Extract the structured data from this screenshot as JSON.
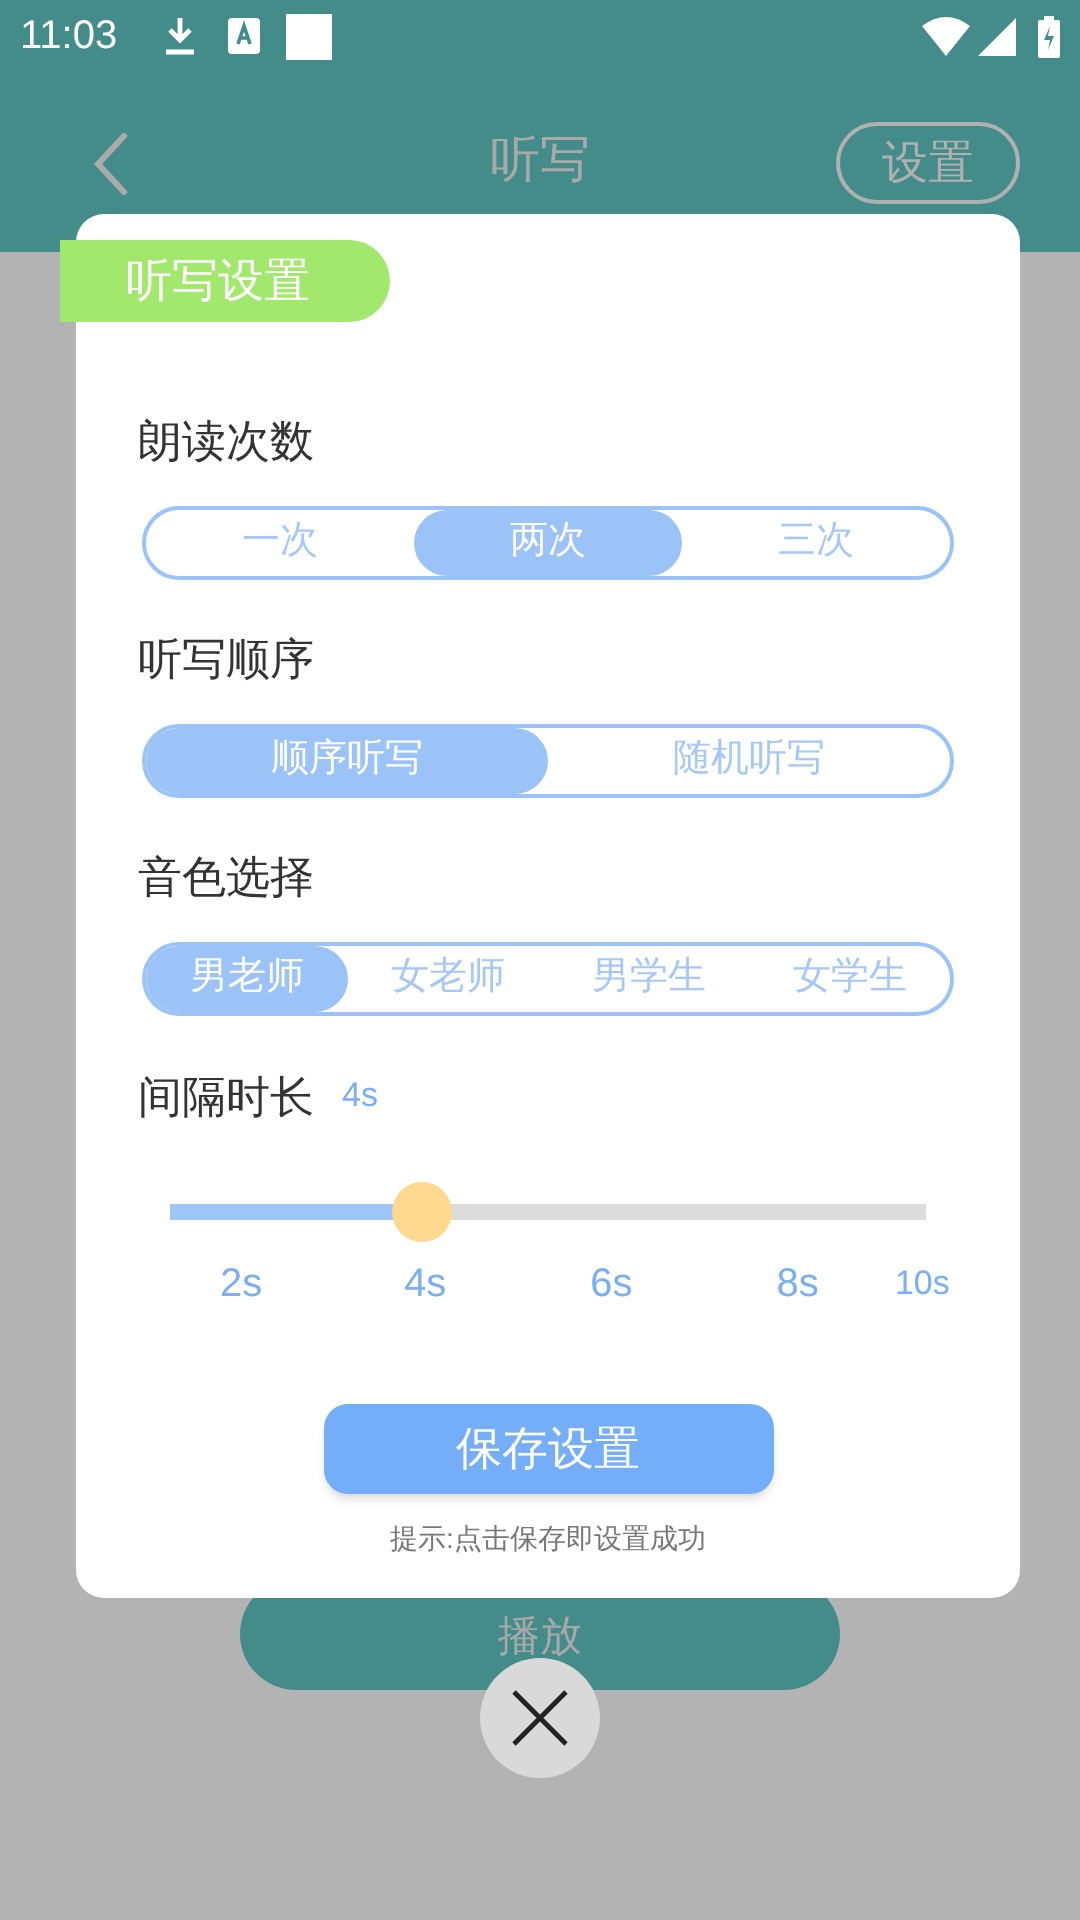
{
  "status_bar": {
    "time": "11:03"
  },
  "header": {
    "title": "听写",
    "action": "设置"
  },
  "dialog": {
    "tag": "听写设置",
    "groups": [
      {
        "label": "朗读次数",
        "options": [
          {
            "label": "一次",
            "selected": false
          },
          {
            "label": "两次",
            "selected": true
          },
          {
            "label": "三次",
            "selected": false
          }
        ]
      },
      {
        "label": "听写顺序",
        "options": [
          {
            "label": "顺序听写",
            "selected": true
          },
          {
            "label": "随机听写",
            "selected": false
          }
        ]
      },
      {
        "label": "音色选择",
        "options": [
          {
            "label": "男老师",
            "selected": true
          },
          {
            "label": "女老师",
            "selected": false
          },
          {
            "label": "男学生",
            "selected": false
          },
          {
            "label": "女学生",
            "selected": false
          }
        ]
      }
    ],
    "interval": {
      "label": "间隔时长",
      "value": "4s",
      "level": 0.333,
      "ticks": [
        "2s",
        "4s",
        "6s",
        "8s",
        "10s"
      ]
    },
    "save_button": "保存设置",
    "hint": "提示:点击保存即设置成功"
  },
  "play_button": "播放"
}
